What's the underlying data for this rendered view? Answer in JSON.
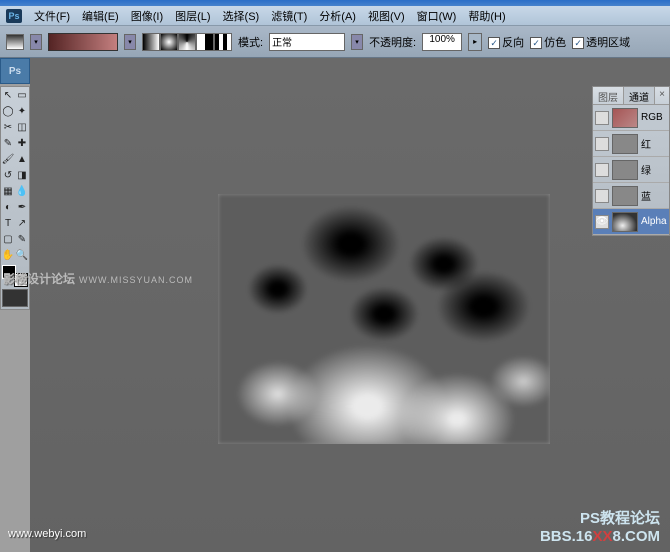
{
  "menu": {
    "file": "文件(F)",
    "edit": "编辑(E)",
    "image": "图像(I)",
    "layer": "图层(L)",
    "select": "选择(S)",
    "filter": "滤镜(T)",
    "analysis": "分析(A)",
    "view": "视图(V)",
    "window": "窗口(W)",
    "help": "帮助(H)"
  },
  "options": {
    "mode_label": "模式:",
    "mode_value": "正常",
    "opacity_label": "不透明度:",
    "opacity_value": "100%",
    "reverse": "反向",
    "dither": "仿色",
    "transparency": "透明区域"
  },
  "dock": {
    "ps": "Ps"
  },
  "panels": {
    "tab_layers": "图层",
    "tab_channels": "通道",
    "ch_rgb": "RGB",
    "ch_r": "红",
    "ch_g": "绿",
    "ch_b": "蓝",
    "ch_alpha": "Alpha"
  },
  "watermarks": {
    "left_main": "影楼设计论坛",
    "left_sub": "WWW.MISSYUAN.COM",
    "br_line1": "PS教程论坛",
    "br_pre": "BBS.16",
    "br_xx": "XX",
    "br_post": "8.COM",
    "bl": "www.webyi.com"
  }
}
